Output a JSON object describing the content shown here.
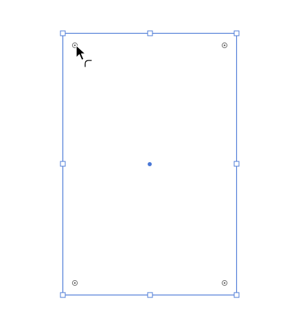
{
  "colors": {
    "canvas_background": "#ffffff",
    "selection_stroke": "#4a78d6",
    "handle_fill": "#ffffff",
    "center_point": "#4a78d6",
    "widget_stroke": "#6a6a6a",
    "cursor_fill": "#000000",
    "cursor_outline": "#ffffff"
  },
  "selection": {
    "object": "rectangle",
    "selected": true,
    "handles": [
      "top-left-handle",
      "top-center-handle",
      "top-right-handle",
      "middle-left-handle",
      "middle-right-handle",
      "bottom-left-handle",
      "bottom-center-handle",
      "bottom-right-handle"
    ],
    "corner_radius_widgets": [
      "top-left-corner-widget",
      "top-right-corner-widget",
      "bottom-left-corner-widget",
      "bottom-right-corner-widget"
    ],
    "center_point": true
  },
  "cursor": {
    "icon": "arrow-cursor-icon",
    "mode_indicator_icon": "rounded-corner-cursor-icon"
  }
}
